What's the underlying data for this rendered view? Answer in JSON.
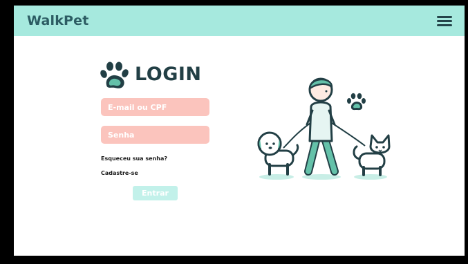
{
  "header": {
    "brand": "WalkPet",
    "menu_icon": "hamburger-menu-icon"
  },
  "login": {
    "title": "LOGIN",
    "title_icon": "paw-icon",
    "email_placeholder": "E-mail ou CPF",
    "password_placeholder": "Senha",
    "forgot_label": "Esqueceu sua senha?",
    "signup_label": "Cadastre-se",
    "submit_label": "Entrar"
  },
  "illustration": {
    "icon": "person-walking-dog-and-cat-illustration"
  },
  "colors": {
    "header_bg": "#a6e9de",
    "brand_text": "#2c5c63",
    "input_bg": "#fbc4bd",
    "button_bg": "#c2f1ea",
    "title_text": "#223f45",
    "accent_green": "#64c1a9"
  }
}
